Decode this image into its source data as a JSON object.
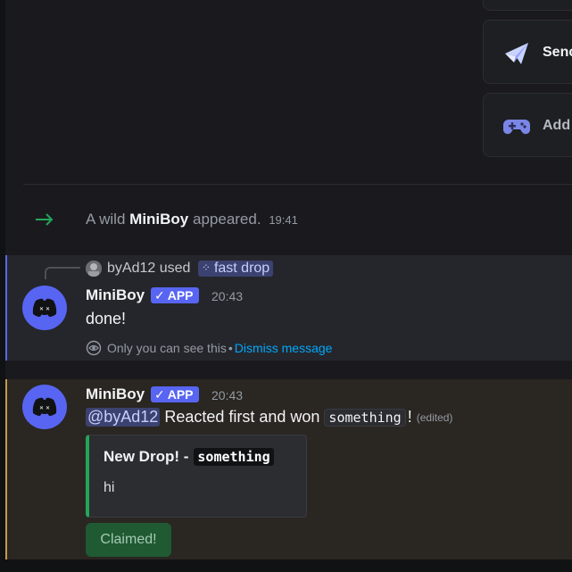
{
  "cards": [
    {
      "label": "",
      "icon": "card-top-icon"
    },
    {
      "label": "Senc",
      "icon": "paper-plane-icon"
    },
    {
      "label": "Add",
      "icon": "gamepad-icon"
    }
  ],
  "system_message": {
    "prefix": "A wild",
    "name": "MiniBoy",
    "suffix": "appeared.",
    "time": "19:41"
  },
  "message1": {
    "reply": {
      "user": "byAd12",
      "action": "used",
      "command": "fast drop"
    },
    "author": "MiniBoy",
    "badge": "APP",
    "time": "20:43",
    "content": "done!",
    "ephemeral": {
      "note": "Only you can see this",
      "separator": "•",
      "dismiss": "Dismiss message"
    }
  },
  "message2": {
    "author": "MiniBoy",
    "badge": "APP",
    "time": "20:43",
    "mention": "@byAd12",
    "text": "Reacted first and won",
    "code": "something",
    "punct": "!",
    "edited": "(edited)",
    "embed": {
      "title": "New Drop! -",
      "title_code": "something",
      "description": "hi",
      "accent": "#23a559"
    },
    "button": "Claimed!"
  },
  "colors": {
    "blurple": "#5865f2",
    "mention_bg": "#3c4270",
    "highlight_border": "#c59a4a",
    "green": "#23a559"
  }
}
